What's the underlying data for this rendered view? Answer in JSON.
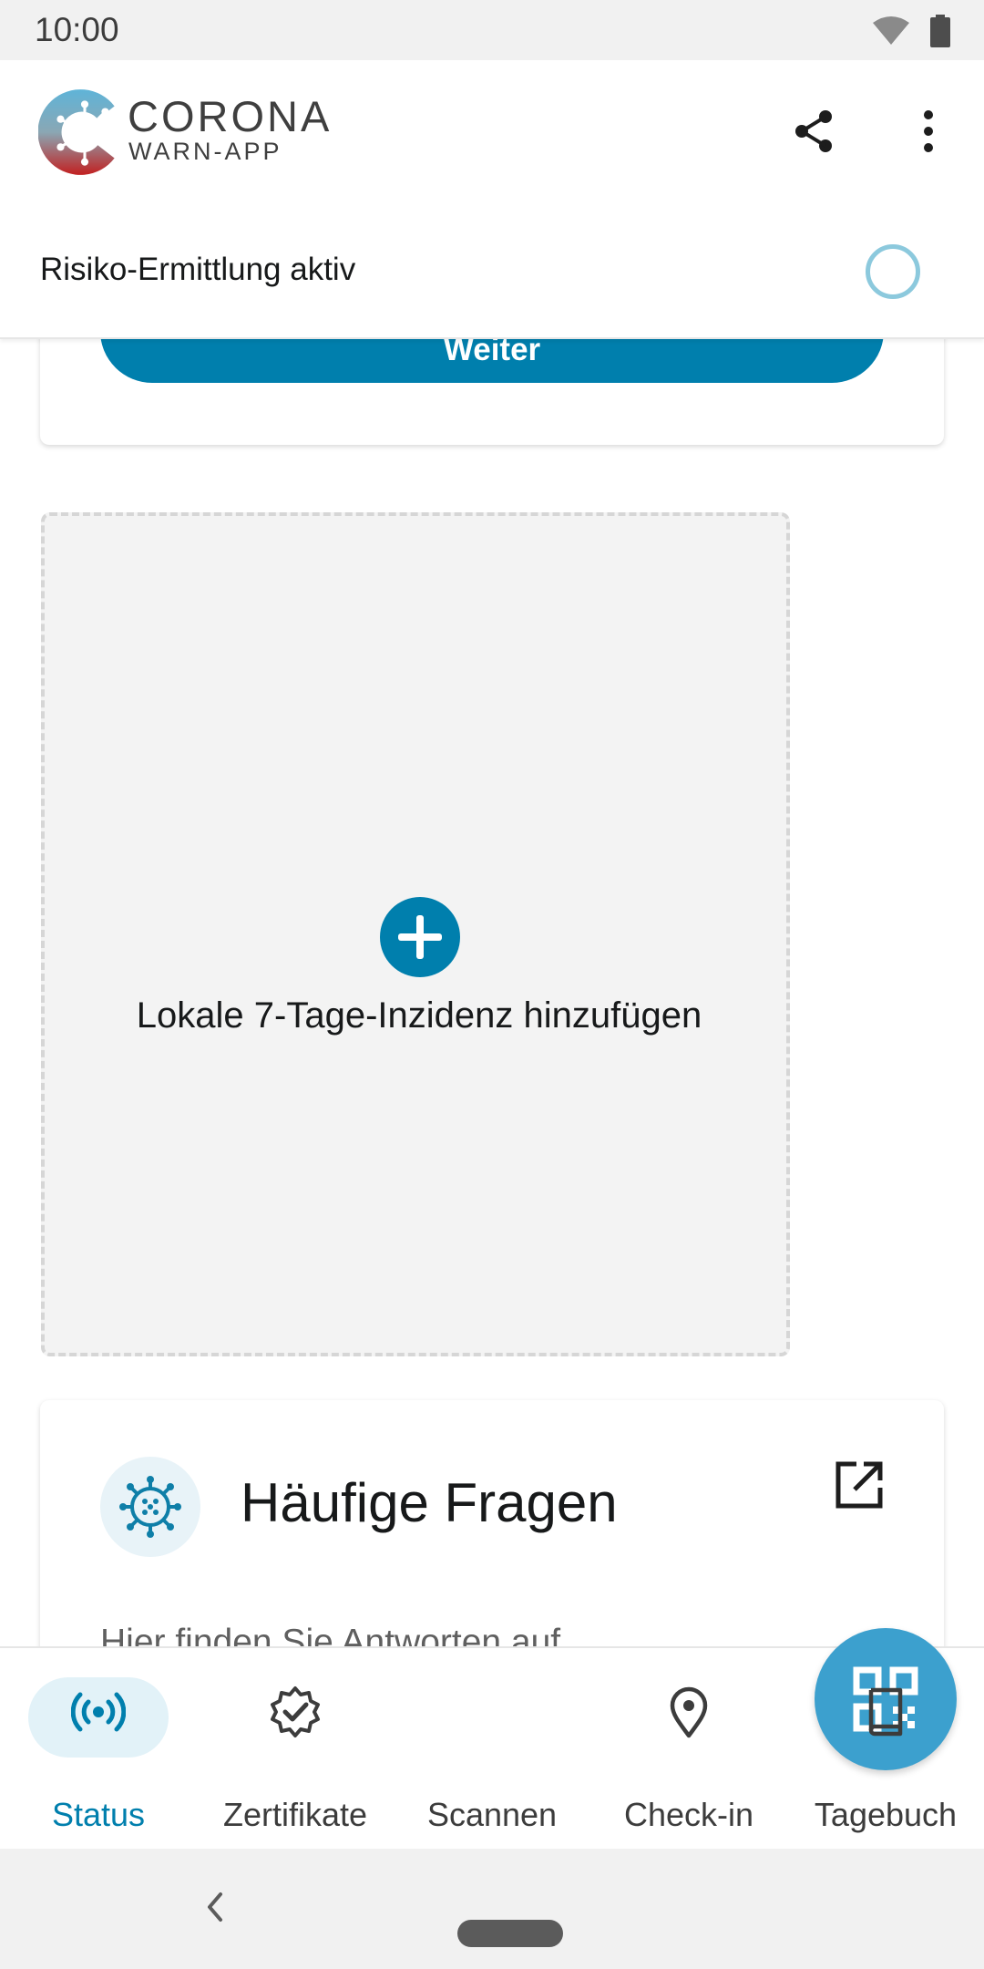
{
  "status_bar": {
    "time": "10:00",
    "icons": [
      "wifi-icon",
      "battery-icon"
    ]
  },
  "app_bar": {
    "brand_name": "CORONA",
    "brand_sub": "WARN-APP",
    "actions": [
      "share-icon",
      "more-vert-icon"
    ]
  },
  "risk": {
    "label": "Risiko-Ermittlung aktiv"
  },
  "top_card": {
    "button_label": "Weiter"
  },
  "inzidenz": {
    "label": "Lokale 7-Tage-Inzidenz hinzufügen"
  },
  "faq": {
    "title": "Häufige Fragen",
    "text": "Hier finden Sie Antworten auf"
  },
  "bottom_nav": {
    "items": [
      {
        "label": "Status",
        "icon": "status-radar-icon",
        "active": true
      },
      {
        "label": "Zertifikate",
        "icon": "certificate-badge-icon",
        "active": false
      },
      {
        "label": "Scannen",
        "icon": "qr-code-icon",
        "active": false
      },
      {
        "label": "Check-in",
        "icon": "location-pin-icon",
        "active": false
      },
      {
        "label": "Tagebuch",
        "icon": "book-icon",
        "active": false
      }
    ]
  },
  "colors": {
    "primary": "#007fad",
    "fab": "#3ca0ce",
    "active_pill": "#e2f2f8",
    "ring": "#8cc9dd"
  }
}
